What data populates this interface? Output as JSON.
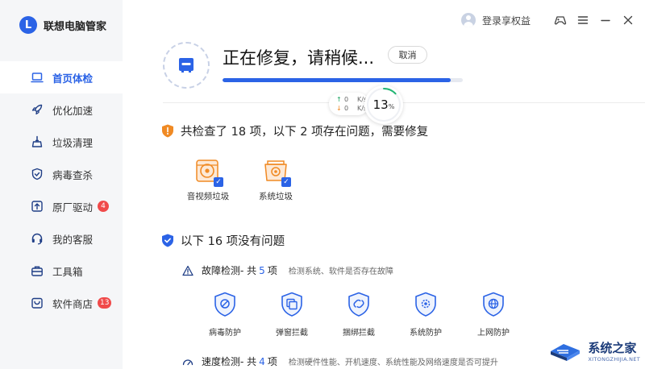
{
  "app": {
    "logo_letter": "L",
    "title": "联想电脑管家"
  },
  "sidebar": {
    "items": [
      {
        "label": "首页体检",
        "icon": "laptop-icon",
        "active": true,
        "badge": ""
      },
      {
        "label": "优化加速",
        "icon": "rocket-icon",
        "active": false,
        "badge": ""
      },
      {
        "label": "垃圾清理",
        "icon": "broom-icon",
        "active": false,
        "badge": ""
      },
      {
        "label": "病毒查杀",
        "icon": "shield-check-icon",
        "active": false,
        "badge": ""
      },
      {
        "label": "原厂驱动",
        "icon": "upload-box-icon",
        "active": false,
        "badge": "4"
      },
      {
        "label": "我的客服",
        "icon": "headset-icon",
        "active": false,
        "badge": ""
      },
      {
        "label": "工具箱",
        "icon": "toolbox-icon",
        "active": false,
        "badge": ""
      },
      {
        "label": "软件商店",
        "icon": "store-icon",
        "active": false,
        "badge": "13"
      }
    ]
  },
  "topbar": {
    "user_label": "登录享权益"
  },
  "repair": {
    "title": "正在修复，请稍候...",
    "cancel_label": "取消",
    "progress_percent": 95,
    "percent_value": "13",
    "percent_unit": "%",
    "upload_speed": "0",
    "download_speed": "0",
    "speed_unit": "K/s"
  },
  "issues_section": {
    "title": "共检查了 18 项，以下 2 项存在问题，需要修复",
    "items": [
      {
        "label": "音视频垃圾",
        "icon": "media-trash-icon",
        "checked": true
      },
      {
        "label": "系统垃圾",
        "icon": "system-trash-icon",
        "checked": true
      }
    ]
  },
  "ok_section": {
    "title": "以下 16 项没有问题",
    "fault_check": {
      "name": "故障检测",
      "prefix": " - 共",
      "count": "5",
      "suffix": "项",
      "desc": "检测系统、软件是否存在故障",
      "items": [
        {
          "label": "病毒防护",
          "icon": "virus-shield-icon"
        },
        {
          "label": "弹窗拦截",
          "icon": "popup-shield-icon"
        },
        {
          "label": "捆绑拦截",
          "icon": "bundle-shield-icon"
        },
        {
          "label": "系统防护",
          "icon": "gear-shield-icon"
        },
        {
          "label": "上网防护",
          "icon": "globe-shield-icon"
        }
      ]
    },
    "speed_check": {
      "name": "速度检测",
      "prefix": " - 共",
      "count": "4",
      "suffix": "项",
      "desc": "检测硬件性能、开机速度、系统性能及网络速度是否可提升"
    }
  },
  "watermark": {
    "main": "系统之家",
    "sub": "XITONGZHIJIA.NET"
  },
  "colors": {
    "accent": "#2b63e6",
    "warning": "#f08a24",
    "badge": "#f04a4a"
  }
}
